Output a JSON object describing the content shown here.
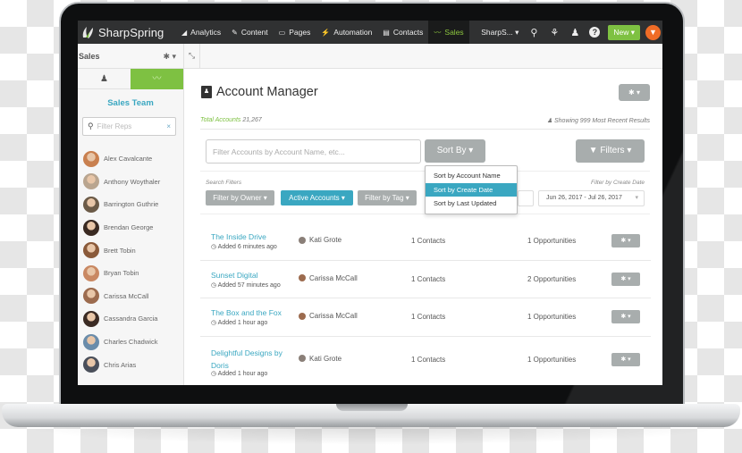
{
  "topnav": {
    "brand": "SharpSpring",
    "items": [
      {
        "label": "Analytics",
        "icon": "chart-icon",
        "glyph": "◢",
        "active": false
      },
      {
        "label": "Content",
        "icon": "pencil-icon",
        "glyph": "✎",
        "active": false
      },
      {
        "label": "Pages",
        "icon": "window-icon",
        "glyph": "▭",
        "active": false
      },
      {
        "label": "Automation",
        "icon": "wand-icon",
        "glyph": "⚡",
        "active": false
      },
      {
        "label": "Contacts",
        "icon": "address-book-icon",
        "glyph": "▤",
        "active": false
      },
      {
        "label": "Sales",
        "icon": "trend-icon",
        "glyph": "〰",
        "active": true
      }
    ],
    "account_label": "SharpS...",
    "account_caret": "▾",
    "search_glyph": "⚲",
    "users_glyph": "⚘",
    "user_glyph": "♟",
    "help_glyph": "?",
    "new_label": "New ▾",
    "pin_glyph": "⚲"
  },
  "subheader": {
    "title": "Sales",
    "gear_glyph": "✱ ▾",
    "collapse_glyph": "⤡"
  },
  "sidebar": {
    "tab_person_glyph": "♟",
    "tab_trend_glyph": "〰",
    "team_title": "Sales Team",
    "search_placeholder": "Filter Reps",
    "search_glyph": "⚲",
    "clear_glyph": "×",
    "reps": [
      {
        "name": "Alex Cavalcante",
        "color": "#c9804f"
      },
      {
        "name": "Anthony Woythaler",
        "color": "#b9a58f"
      },
      {
        "name": "Barrington Guthrie",
        "color": "#6b5a47"
      },
      {
        "name": "Brendan George",
        "color": "#3a2a22"
      },
      {
        "name": "Brett Tobin",
        "color": "#8a5a3a"
      },
      {
        "name": "Bryan Tobin",
        "color": "#c98862"
      },
      {
        "name": "Carissa McCall",
        "color": "#9c6b4e"
      },
      {
        "name": "Cassandra Garcia",
        "color": "#3b2b24"
      },
      {
        "name": "Charles Chadwick",
        "color": "#6a8caa"
      },
      {
        "name": "Chris Arias",
        "color": "#4a4f5a"
      }
    ]
  },
  "main": {
    "title": "Account Manager",
    "title_icon_glyph": "♟",
    "gear_label": "✱ ▾",
    "total_label": "Total Accounts",
    "total_value": "21,267",
    "showing_text": "♟ Showing 999 Most Recent Results",
    "search_placeholder": "Filter Accounts by Account Name, etc...",
    "sortby_label": "Sort By ▾",
    "filters_label": "▼ Filters ▾",
    "search_filters_label": "Search Filters",
    "filter_create_label": "Filter by Create Date",
    "chips": [
      {
        "label": "Filter by Owner ▾",
        "style": "grey"
      },
      {
        "label": "Active Accounts ▾",
        "style": "teal"
      },
      {
        "label": "Filter by Tag ▾",
        "style": "grey"
      }
    ],
    "date_range": "Jun 26, 2017 - Jul 26, 2017",
    "date_caret": "▾",
    "sort_options": [
      {
        "label": "Sort by Account Name",
        "active": false
      },
      {
        "label": "Sort by Create Date",
        "active": true
      },
      {
        "label": "Sort by Last Updated",
        "active": false
      }
    ],
    "rows": [
      {
        "name": "The Inside Drive",
        "added": "Added 6 minutes ago",
        "owner": "Kati Grote",
        "owner_color": "#8a7f78",
        "contacts": "1 Contacts",
        "opportunities": "1 Opportunities",
        "gear": "✱ ▾"
      },
      {
        "name": "Sunset Digital",
        "added": "Added 57 minutes ago",
        "owner": "Carissa McCall",
        "owner_color": "#9c6b4e",
        "contacts": "1 Contacts",
        "opportunities": "2 Opportunities",
        "gear": "✱ ▾"
      },
      {
        "name": "The Box and the Fox",
        "added": "Added 1 hour ago",
        "owner": "Carissa McCall",
        "owner_color": "#9c6b4e",
        "contacts": "1 Contacts",
        "opportunities": "1 Opportunities",
        "gear": "✱ ▾"
      },
      {
        "name": "Delightful Designs by Doris",
        "added": "Added 1 hour ago",
        "owner": "Kati Grote",
        "owner_color": "#8a7f78",
        "contacts": "1 Contacts",
        "opportunities": "1 Opportunities",
        "gear": "✱ ▾"
      }
    ],
    "clock_glyph": "◷"
  },
  "colors": {
    "brand_green": "#7ec142",
    "accent_teal": "#3aa7c1",
    "nav_dark": "#303132",
    "pin_orange": "#f06c26",
    "button_grey": "#a8adad"
  }
}
